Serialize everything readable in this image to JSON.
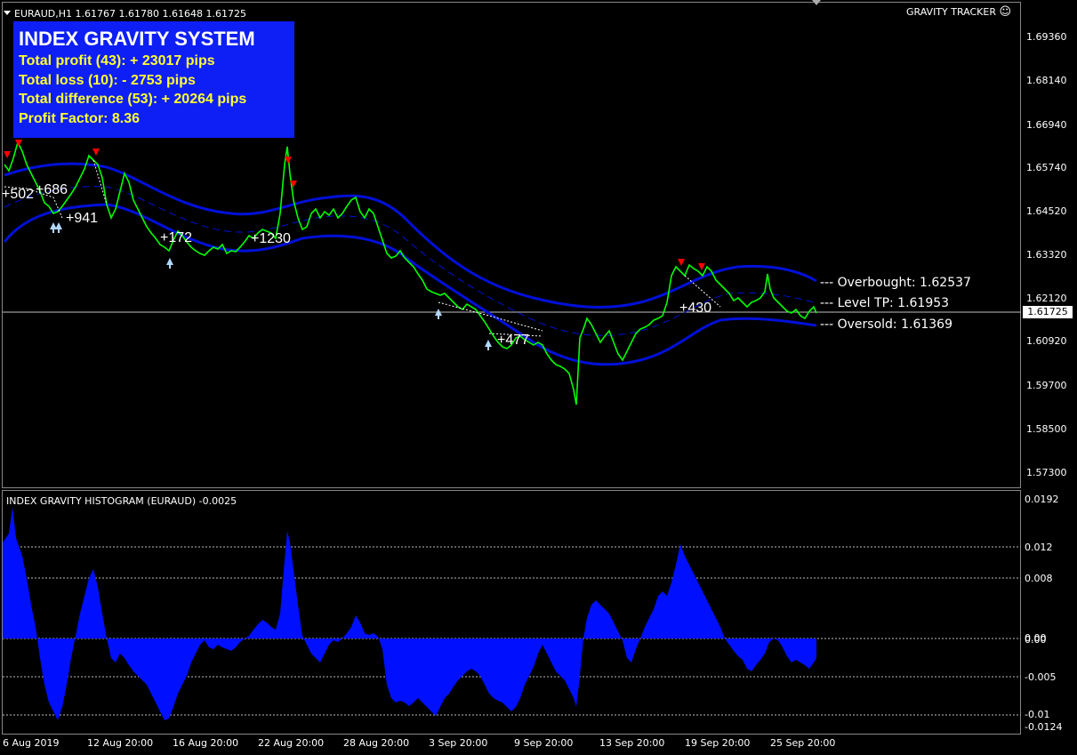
{
  "symbol_header": "EURAUD,H1  1.61767 1.61780 1.61648 1.61725",
  "tracker_label": "GRAVITY TRACKER",
  "tracker_icon": "smiley-icon",
  "stats": {
    "title": "INDEX GRAVITY SYSTEM",
    "total_profit": "Total profit (43):  + 23017 pips",
    "total_loss": "Total loss (10):  - 2753 pips",
    "total_difference": "Total difference (53):  + 20264 pips",
    "profit_factor": "Profit Factor:  8.36"
  },
  "levels": {
    "overbought": "--- Overbought: 1.62537",
    "level_tp": "--- Level TP: 1.61953",
    "oversold": "--- Oversold: 1.61369"
  },
  "current_price": "1.61725",
  "price_axis": [
    "1.69360",
    "1.68140",
    "1.66940",
    "1.65740",
    "1.64520",
    "1.63320",
    "1.62120",
    "1.60920",
    "1.59700",
    "1.58500",
    "1.57300"
  ],
  "indicator": {
    "title": "INDEX GRAVITY HISTOGRAM (EURAUD) -0.0025",
    "axis": [
      "0.0192",
      "0.012",
      "0.008",
      "0.00",
      "0.00",
      "-0.005",
      "-0.01",
      "-0.0124"
    ]
  },
  "trade_labels": [
    "+502",
    "+686",
    "+941",
    "+172",
    "+1230",
    "+477",
    "+430"
  ],
  "time_axis": [
    "6 Aug 2019",
    "12 Aug 20:00",
    "16 Aug 20:00",
    "22 Aug 20:00",
    "28 Aug 20:00",
    "3 Sep 20:00",
    "9 Sep 20:00",
    "13 Sep 20:00",
    "19 Sep 20:00",
    "25 Sep 20:00"
  ],
  "colors": {
    "price": "#00ff00",
    "band": "#0010d8",
    "histogram": "#0010ff",
    "stats_bg": "#0d1ff5",
    "stats_text": "#ffff33",
    "sell_arrow": "#ff0000",
    "buy_arrow": "#b0d8ff"
  }
}
